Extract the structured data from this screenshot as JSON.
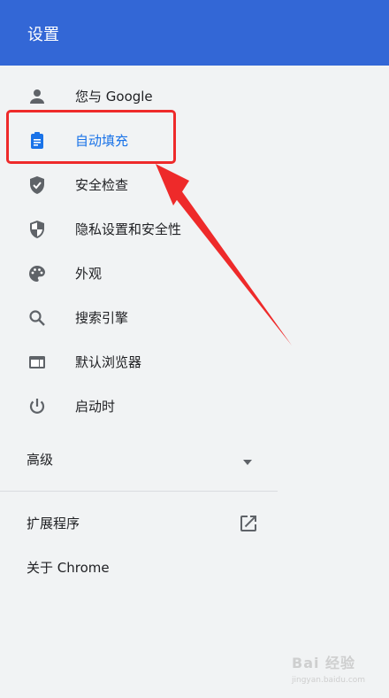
{
  "header": {
    "title": "设置"
  },
  "nav": {
    "items": [
      {
        "id": "you-and-google",
        "label": "您与 Google",
        "icon": "person-icon"
      },
      {
        "id": "autofill",
        "label": "自动填充",
        "icon": "clipboard-icon",
        "active": true
      },
      {
        "id": "safety-check",
        "label": "安全检查",
        "icon": "shield-check-icon"
      },
      {
        "id": "privacy",
        "label": "隐私设置和安全性",
        "icon": "shield-half-icon"
      },
      {
        "id": "appearance",
        "label": "外观",
        "icon": "palette-icon"
      },
      {
        "id": "search-engine",
        "label": "搜索引擎",
        "icon": "search-icon"
      },
      {
        "id": "default-browser",
        "label": "默认浏览器",
        "icon": "browser-window-icon"
      },
      {
        "id": "on-startup",
        "label": "启动时",
        "icon": "power-icon"
      }
    ],
    "advanced_label": "高级",
    "extensions_label": "扩展程序",
    "about_label": "关于 Chrome"
  },
  "watermark": {
    "text": "Bai 经验",
    "sub": "jingyan.baidu.com"
  },
  "colors": {
    "header": "#3367d6",
    "active": "#1a73e8",
    "annotation": "#ee2a2a",
    "icon": "#5f6368"
  }
}
